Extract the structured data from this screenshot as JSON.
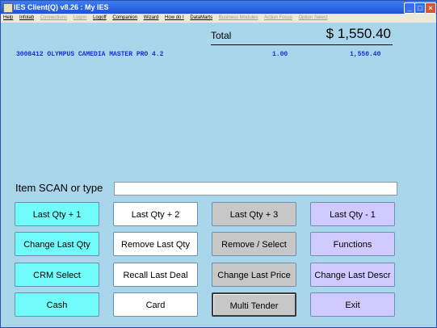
{
  "window": {
    "title": "IES Client(Q) v8.26 : My IES"
  },
  "menu": [
    {
      "label": "Help",
      "enabled": true
    },
    {
      "label": "Infolab",
      "enabled": true
    },
    {
      "label": "Connections",
      "enabled": false
    },
    {
      "label": "Logon",
      "enabled": false
    },
    {
      "label": "Logoff",
      "enabled": true
    },
    {
      "label": "Companion",
      "enabled": true
    },
    {
      "label": "Wizard",
      "enabled": true
    },
    {
      "label": "How do I",
      "enabled": true
    },
    {
      "label": "DataMarts",
      "enabled": true
    },
    {
      "label": "Business Modules",
      "enabled": false
    },
    {
      "label": "Action Focus",
      "enabled": false
    },
    {
      "label": "Option Select",
      "enabled": false
    }
  ],
  "sale": {
    "total_label": "Total",
    "total_value": "$ 1,550.40",
    "items": [
      {
        "description": "3008412 OLYMPUS CAMEDIA MASTER PRO 4.2",
        "qty": "1.00",
        "amount": "1,550.40"
      }
    ]
  },
  "scan": {
    "label": "Item SCAN or type",
    "value": ""
  },
  "buttons": [
    {
      "label": "Last Qty + 1",
      "color": "#72fbfb"
    },
    {
      "label": "Last Qty + 2",
      "color": "#ffffff"
    },
    {
      "label": "Last Qty + 3",
      "color": "#c7c7c7"
    },
    {
      "label": "Last Qty - 1",
      "color": "#cfcaff"
    },
    {
      "label": "Change Last Qty",
      "color": "#72fbfb"
    },
    {
      "label": "Remove Last Qty",
      "color": "#ffffff"
    },
    {
      "label": "Remove / Select",
      "color": "#c7c7c7"
    },
    {
      "label": "Functions",
      "color": "#cfcaff"
    },
    {
      "label": "CRM Select",
      "color": "#72fbfb"
    },
    {
      "label": "Recall Last Deal",
      "color": "#ffffff"
    },
    {
      "label": "Change Last Price",
      "color": "#c7c7c7"
    },
    {
      "label": "Change Last Descr",
      "color": "#cfcaff"
    },
    {
      "label": "Cash",
      "color": "#72fbfb"
    },
    {
      "label": "Card",
      "color": "#ffffff"
    },
    {
      "label": "Multi Tender",
      "color": "#c7c7c7"
    },
    {
      "label": "Exit",
      "color": "#cfcaff"
    }
  ]
}
